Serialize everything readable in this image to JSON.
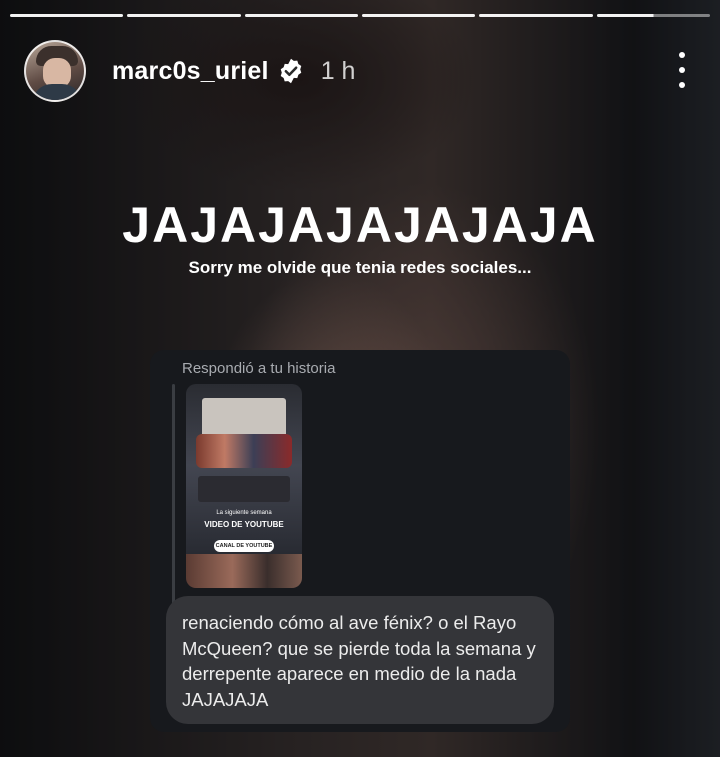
{
  "story": {
    "progress_segments": 6,
    "active_segment_index": 5,
    "active_segment_progress": 0.5
  },
  "header": {
    "username": "marc0s_uriel",
    "verified": true,
    "time": "1 h",
    "more_icon": "more-vertical-icon"
  },
  "overlay": {
    "title": "JAJAJAJAJAJAJA",
    "subtitle": "Sorry me olvide que tenia redes sociales..."
  },
  "reply": {
    "label": "Respondió a tu historia",
    "thumbnail": {
      "small_text": "La siguiente semana",
      "headline": "VIDEO DE YOUTUBE",
      "pill": "CANAL DE YOUTUBE"
    },
    "message": "renaciendo cómo al ave fénix? o el Rayo McQueen? que se pierde toda la semana y derrepente aparece en medio de la nada JAJAJAJA"
  },
  "colors": {
    "card_bg": "#17191d",
    "bubble_bg": "#343539",
    "text": "#ffffff",
    "muted": "#a8abb0"
  }
}
